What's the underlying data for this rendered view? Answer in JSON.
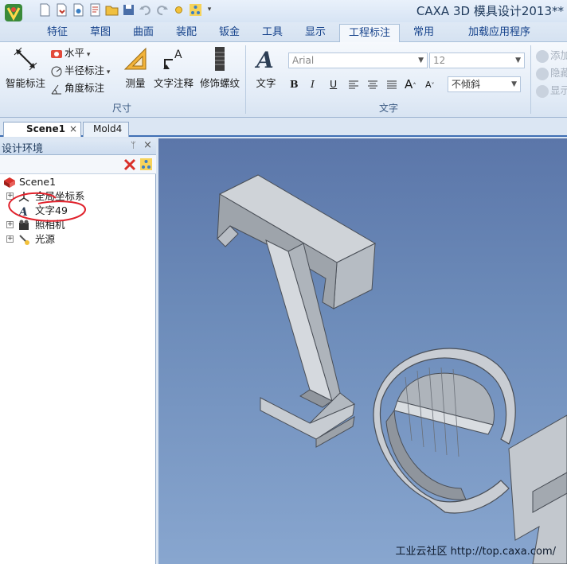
{
  "window": {
    "title": "CAXA 3D 模具设计2013**"
  },
  "ribbon_tabs": [
    "特征",
    "草图",
    "曲面",
    "装配",
    "钣金",
    "工具",
    "显示",
    "工程标注",
    "常用",
    "加载应用程序"
  ],
  "ribbon_active_tab": "工程标注",
  "ribbon": {
    "dimension_group": {
      "label": "尺寸",
      "smart_dim": "智能标注",
      "horizontal": "水平",
      "radius": "半径标注",
      "angle": "角度标注",
      "measure": "测量",
      "text_note": "文字注释",
      "thread": "修饰螺纹"
    },
    "text_group": {
      "label": "文字",
      "text_btn": "文字",
      "font_value": "Arial",
      "size_value": "12",
      "slant_value": "不倾斜"
    },
    "side_group": {
      "add": "添加",
      "hide": "隐藏",
      "show": "显示"
    }
  },
  "doc_tabs": [
    {
      "label": "Scene1",
      "active": true
    },
    {
      "label": "Mold4",
      "active": false
    }
  ],
  "panel": {
    "title": "设计环境",
    "tree": [
      {
        "label": "Scene1",
        "icon": "scene-icon",
        "level": 0
      },
      {
        "label": "全局坐标系",
        "icon": "axis-icon",
        "level": 1,
        "expandable": true
      },
      {
        "label": "文字49",
        "icon": "text-icon",
        "level": 1,
        "expandable": false
      },
      {
        "label": "照相机",
        "icon": "camera-icon",
        "level": 1,
        "expandable": true
      },
      {
        "label": "光源",
        "icon": "light-icon",
        "level": 1,
        "expandable": true
      }
    ]
  },
  "viewport": {
    "watermark": "工业云社区 http://top.caxa.com/"
  },
  "colors": {
    "ribbon_accent": "#15428b",
    "annotation_red": "#e0202a",
    "viewport_top": "#5b76a9",
    "viewport_bottom": "#88a6cf"
  }
}
